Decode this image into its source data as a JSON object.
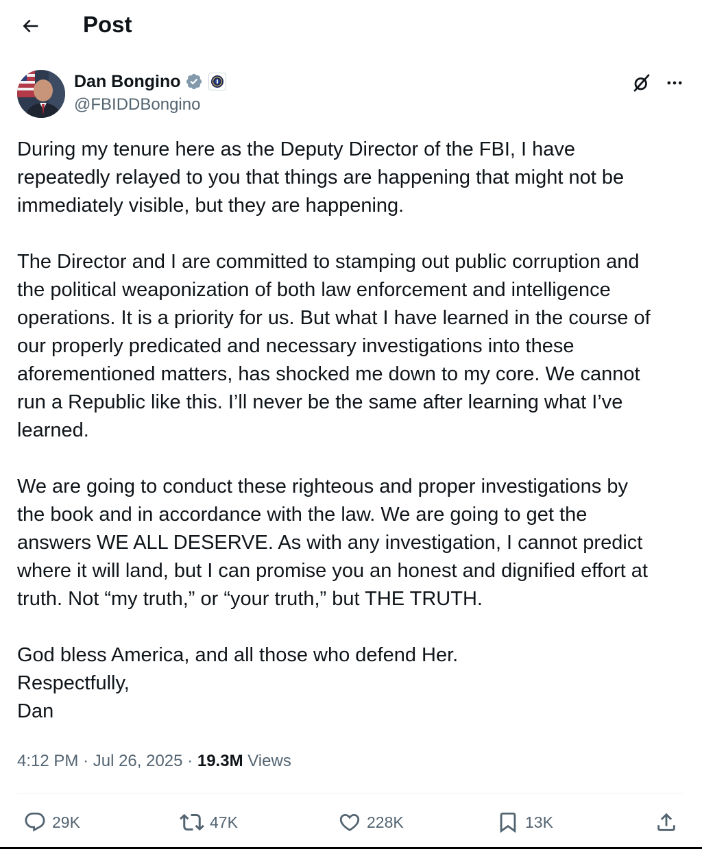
{
  "header": {
    "title": "Post"
  },
  "icons": {
    "back": "arrow-left-icon",
    "verified": "verified-badge-icon",
    "affiliation": "fbi-seal-icon",
    "grok": "grok-icon",
    "more": "more-icon",
    "reply": "reply-icon",
    "repost": "repost-icon",
    "like": "heart-icon",
    "bookmark": "bookmark-icon",
    "share": "share-icon"
  },
  "colors": {
    "text": "#0f1419",
    "secondary": "#536471",
    "verified": "#829aab"
  },
  "author": {
    "name": "Dan Bongino",
    "handle": "@FBIDDBongino"
  },
  "post": {
    "paragraphs": [
      [
        "During my tenure here as the Deputy Director of the FBI, I have",
        "repeatedly relayed to you that things are happening that might not be",
        "immediately visible, but they are happening."
      ],
      [
        "The Director and I are committed to stamping out public corruption and",
        "the political weaponization of both law enforcement and intelligence",
        "operations. It is a priority for us. But what I have learned in the course of",
        "our properly predicated and necessary investigations into these",
        "aforementioned matters, has shocked me down to my core. We cannot",
        "run a Republic like this. I’ll never be the same after learning what I’ve",
        "learned."
      ],
      [
        "We are going to conduct these righteous and proper investigations by",
        "the book and in accordance with the law. We are going to get the",
        "answers WE ALL DESERVE. As with any investigation, I cannot predict",
        "where it will land, but I can promise you an honest and dignified effort at",
        "truth. Not “my truth,” or “your truth,” but THE TRUTH."
      ],
      [
        "God bless America, and all those who defend Her.",
        "Respectfully,",
        "Dan"
      ]
    ],
    "time": "4:12 PM",
    "date": "Jul 26, 2025",
    "views_count": "19.3M",
    "views_label": "Views"
  },
  "actions": {
    "replies": "29K",
    "reposts": "47K",
    "likes": "228K",
    "bookmarks": "13K"
  }
}
